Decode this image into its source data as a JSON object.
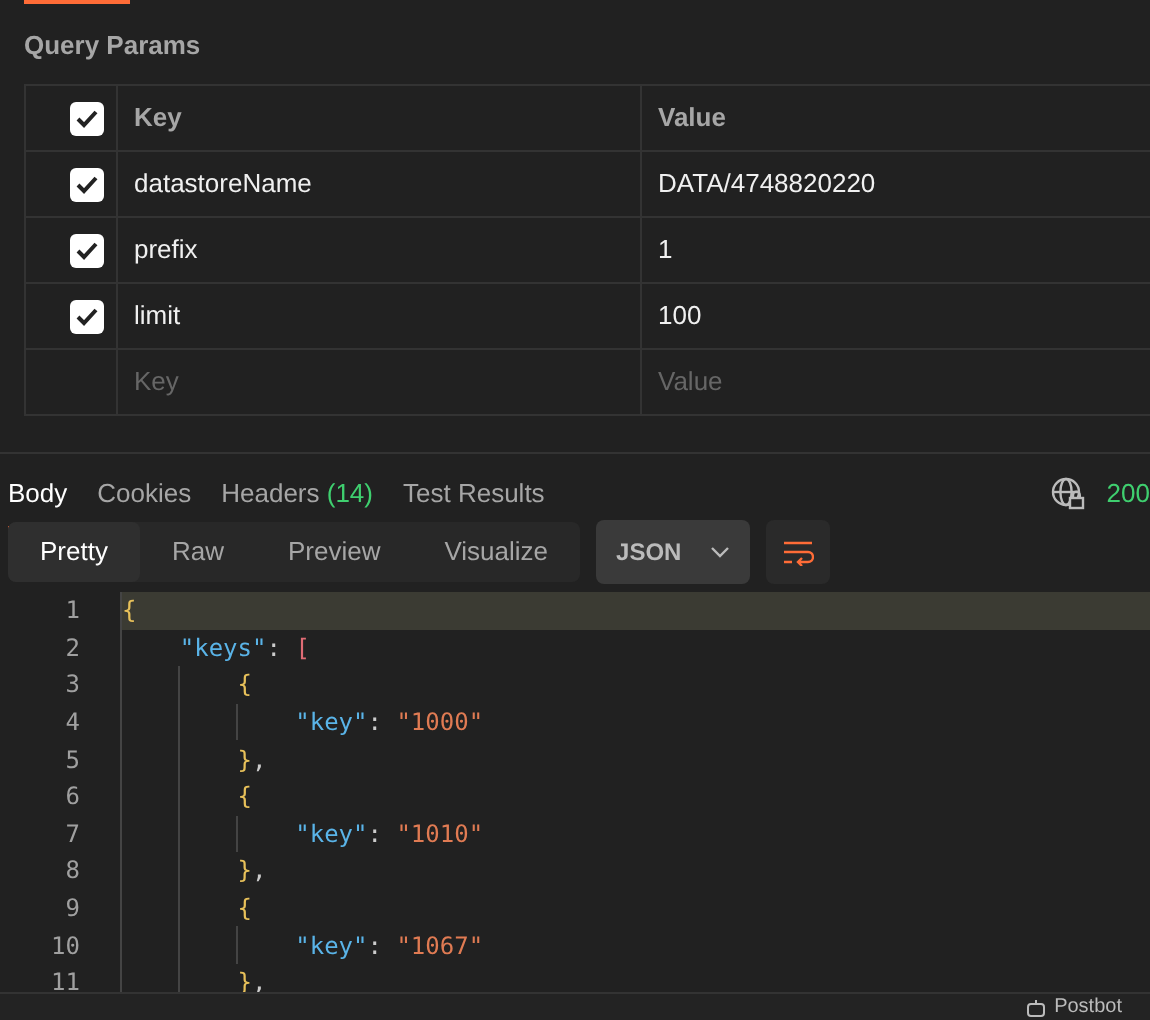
{
  "section_title": "Query Params",
  "params": {
    "columns": [
      "Key",
      "Value"
    ],
    "header_checked": true,
    "rows": [
      {
        "key": "datastoreName",
        "value": "DATA/4748820220",
        "checked": true
      },
      {
        "key": "prefix",
        "value": "1",
        "checked": true
      },
      {
        "key": "limit",
        "value": "100",
        "checked": true
      }
    ],
    "new_row": {
      "key_placeholder": "Key",
      "value_placeholder": "Value"
    }
  },
  "response_tabs": [
    {
      "label": "Body",
      "selected": true
    },
    {
      "label": "Cookies",
      "selected": false
    },
    {
      "label": "Headers",
      "count": "(14)",
      "selected": false
    },
    {
      "label": "Test Results",
      "selected": false
    }
  ],
  "status": "200",
  "view_modes": [
    {
      "label": "Pretty",
      "selected": true
    },
    {
      "label": "Raw",
      "selected": false
    },
    {
      "label": "Preview",
      "selected": false
    },
    {
      "label": "Visualize",
      "selected": false
    }
  ],
  "format": "JSON",
  "code_lines": [
    {
      "number": "1",
      "highlighted": true,
      "tokens": [
        {
          "kind": "brace",
          "text": "{"
        }
      ],
      "children": [
        {
          "number": "2",
          "highlighted": false,
          "tokens": [
            {
              "kind": "key",
              "text": "\"keys\""
            },
            {
              "kind": "punct",
              "text": ": "
            },
            {
              "kind": "bracket",
              "text": "["
            }
          ],
          "children": [
            {
              "number": "3",
              "highlighted": false,
              "tokens": [
                {
                  "kind": "brace",
                  "text": "{"
                }
              ],
              "children": [
                {
                  "number": "4",
                  "highlighted": false,
                  "tokens": [
                    {
                      "kind": "key",
                      "text": "\"key\""
                    },
                    {
                      "kind": "punct",
                      "text": ": "
                    },
                    {
                      "kind": "string",
                      "text": "\"1000\""
                    }
                  ]
                }
              ]
            },
            {
              "number": "5",
              "highlighted": false,
              "tokens": [
                {
                  "kind": "brace",
                  "text": "}"
                },
                {
                  "kind": "punct",
                  "text": ","
                }
              ]
            },
            {
              "number": "6",
              "highlighted": false,
              "tokens": [
                {
                  "kind": "brace",
                  "text": "{"
                }
              ],
              "children": [
                {
                  "number": "7",
                  "highlighted": false,
                  "tokens": [
                    {
                      "kind": "key",
                      "text": "\"key\""
                    },
                    {
                      "kind": "punct",
                      "text": ": "
                    },
                    {
                      "kind": "string",
                      "text": "\"1010\""
                    }
                  ]
                }
              ]
            },
            {
              "number": "8",
              "highlighted": false,
              "tokens": [
                {
                  "kind": "brace",
                  "text": "}"
                },
                {
                  "kind": "punct",
                  "text": ","
                }
              ]
            },
            {
              "number": "9",
              "highlighted": false,
              "tokens": [
                {
                  "kind": "brace",
                  "text": "{"
                }
              ],
              "children": [
                {
                  "number": "10",
                  "highlighted": false,
                  "tokens": [
                    {
                      "kind": "key",
                      "text": "\"key\""
                    },
                    {
                      "kind": "punct",
                      "text": ": "
                    },
                    {
                      "kind": "string",
                      "text": "\"1067\""
                    }
                  ]
                }
              ]
            },
            {
              "number": "11",
              "highlighted": false,
              "tokens": [
                {
                  "kind": "brace",
                  "text": "}"
                },
                {
                  "kind": "punct",
                  "text": ","
                }
              ]
            }
          ]
        }
      ]
    }
  ],
  "status_bar": {
    "postbot": "Postbot"
  }
}
